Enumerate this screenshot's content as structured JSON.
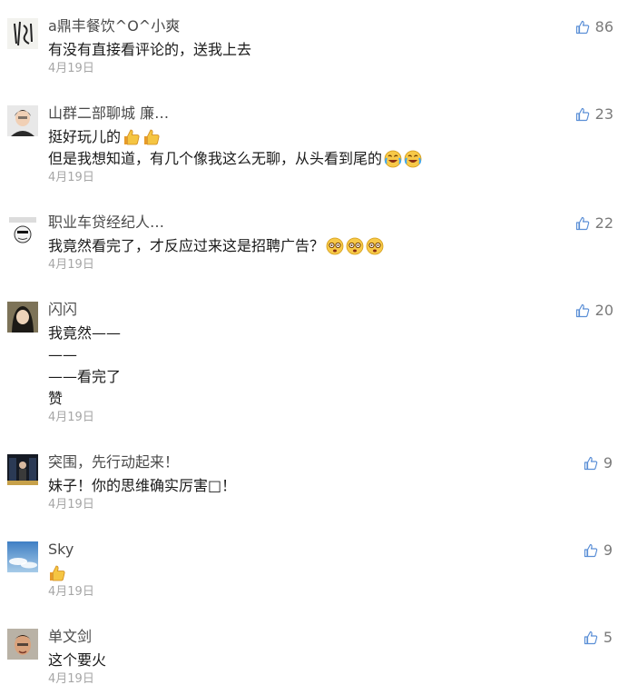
{
  "comments": [
    {
      "name": "a鼎丰餐饮^O^小爽",
      "lines": [
        "有没有直接看评论的，送我上去"
      ],
      "date": "4月19日",
      "likes": "86"
    },
    {
      "name": "山群二部聊城 廉…",
      "lines": [
        "挺好玩儿的",
        "但是我想知道，有几个像我这么无聊，从头看到尾的"
      ],
      "date": "4月19日",
      "likes": "23"
    },
    {
      "name": "职业车贷经纪人…",
      "lines": [
        "我竟然看完了，才反应过来这是招聘广告？"
      ],
      "date": "4月19日",
      "likes": "22"
    },
    {
      "name": "闪闪",
      "lines": [
        "我竟然——",
        "——",
        "——看完了",
        "赞"
      ],
      "date": "4月19日",
      "likes": "20"
    },
    {
      "name": "突围，先行动起来！",
      "lines": [
        "妹子！你的思维确实厉害□！"
      ],
      "date": "4月19日",
      "likes": "9"
    },
    {
      "name": "Sky",
      "lines": [
        ""
      ],
      "date": "4月19日",
      "likes": "9"
    },
    {
      "name": "单文剑",
      "lines": [
        "这个要火"
      ],
      "date": "4月19日",
      "likes": "5"
    }
  ],
  "icons": {
    "like": "thumb-up-outline-icon",
    "thumbs_up_emoji": "thumbs-up-emoji-icon",
    "laughing_crying_emoji": "laugh-cry-emoji-icon",
    "dizzy_emoji": "dizzy-face-emoji-icon"
  },
  "colors": {
    "name": "#4a4a4a",
    "text": "#1a1a1a",
    "date": "#a6a6a6",
    "like": "#7b7b7b",
    "like_icon": "#5b8fd6"
  }
}
